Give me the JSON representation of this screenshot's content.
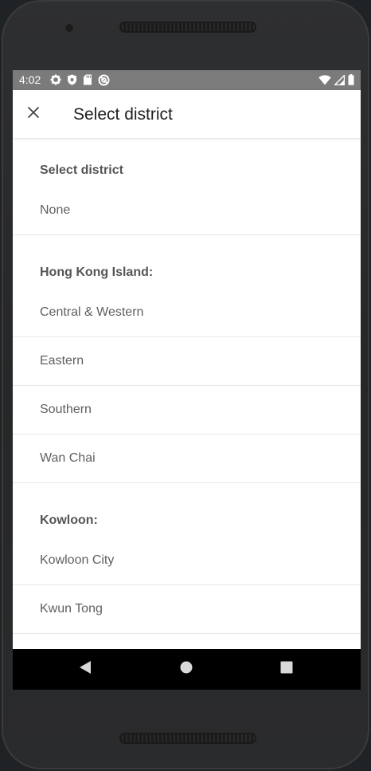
{
  "status_bar": {
    "time": "4:02",
    "icons_left": [
      "settings-icon",
      "shield-icon",
      "sd-card-icon",
      "do-not-disturb-icon"
    ],
    "icons_right": [
      "wifi-icon",
      "signal-icon",
      "battery-icon"
    ]
  },
  "app_bar": {
    "title": "Select district",
    "close_icon": "close-icon"
  },
  "sections": [
    {
      "header": "Select district",
      "items": [
        "None"
      ]
    },
    {
      "header": "Hong Kong Island:",
      "items": [
        "Central & Western",
        "Eastern",
        "Southern",
        "Wan Chai"
      ]
    },
    {
      "header": "Kowloon:",
      "items": [
        "Kowloon City",
        "Kwun Tong"
      ]
    }
  ],
  "nav_bar": {
    "buttons": [
      "back-icon",
      "home-icon",
      "recents-icon"
    ]
  },
  "colors": {
    "status_bar": "#7b7b7b",
    "screen_background": "#ffffff",
    "section_header_text": "#555555",
    "item_text": "#5f5f5f",
    "divider": "#e7e7e7",
    "nav_bar": "#000000",
    "device_frame": "#2a2b2c"
  }
}
